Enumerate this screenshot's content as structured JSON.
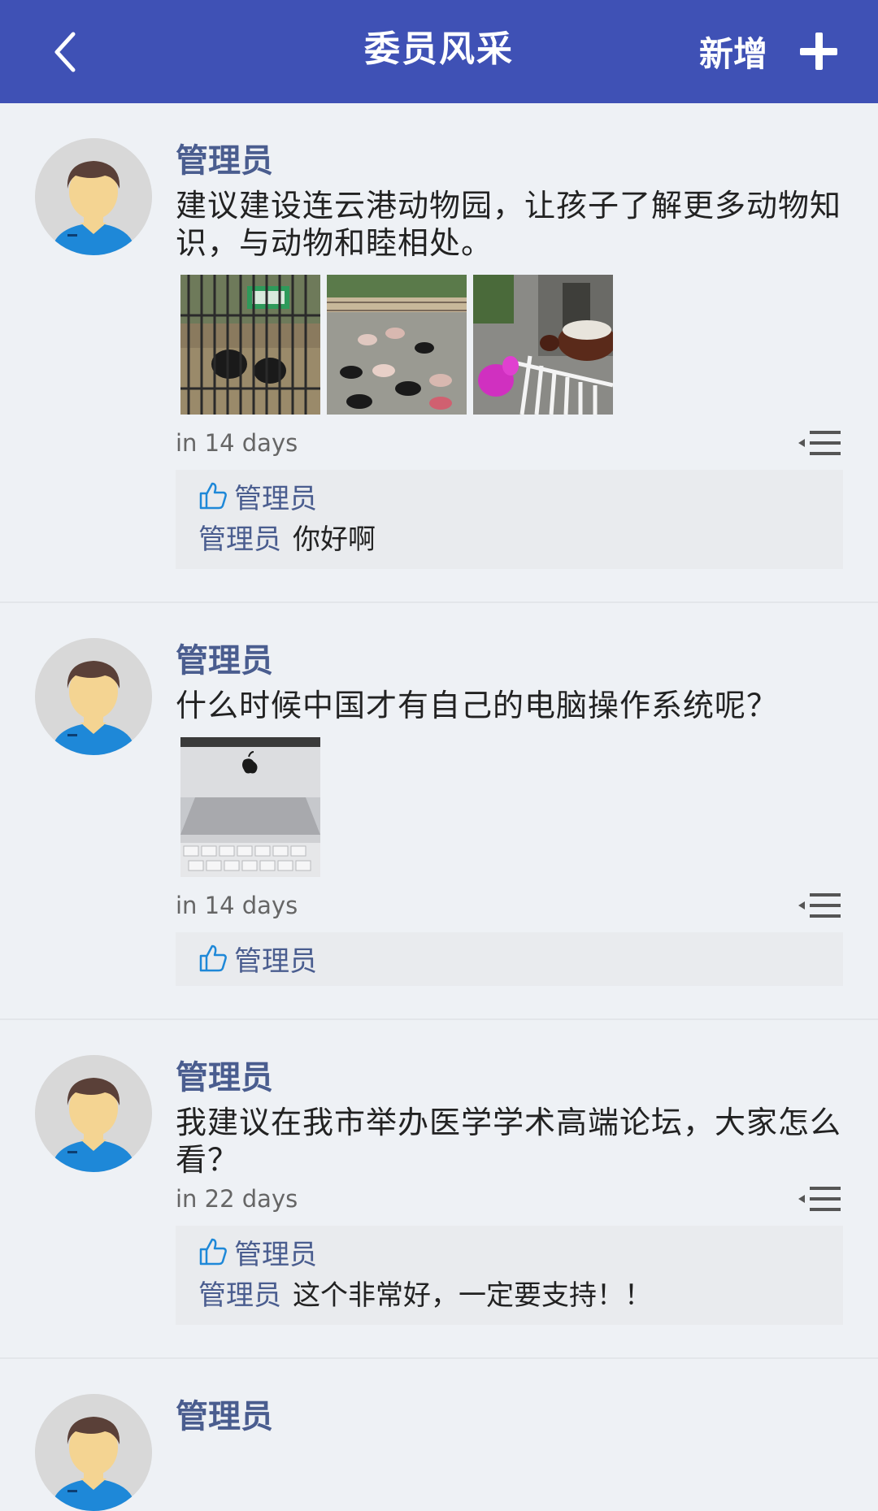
{
  "header": {
    "title": "委员风采",
    "add_label": "新增",
    "back_icon": "chevron-left-icon",
    "add_icon": "plus-icon",
    "background_color": "#3f51b5"
  },
  "posts": [
    {
      "author": "管理员",
      "text": "建议建设连云港动物园，让孩子了解更多动物知识，与动物和睦相处。",
      "timestamp": "in 14 days",
      "likes": "管理员",
      "comments": [
        {
          "author": "管理员",
          "text": "你好啊"
        }
      ]
    },
    {
      "author": "管理员",
      "text": "什么时候中国才有自己的电脑操作系统呢？",
      "timestamp": "in 14 days",
      "likes": "管理员",
      "comments": []
    },
    {
      "author": "管理员",
      "text": "我建议在我市举办医学学术高端论坛，大家怎么看？",
      "timestamp": "in 22 days",
      "likes": "管理员",
      "comments": [
        {
          "author": "管理员",
          "text": "这个非常好，一定要支持！！"
        }
      ]
    },
    {
      "author": "管理员"
    }
  ]
}
